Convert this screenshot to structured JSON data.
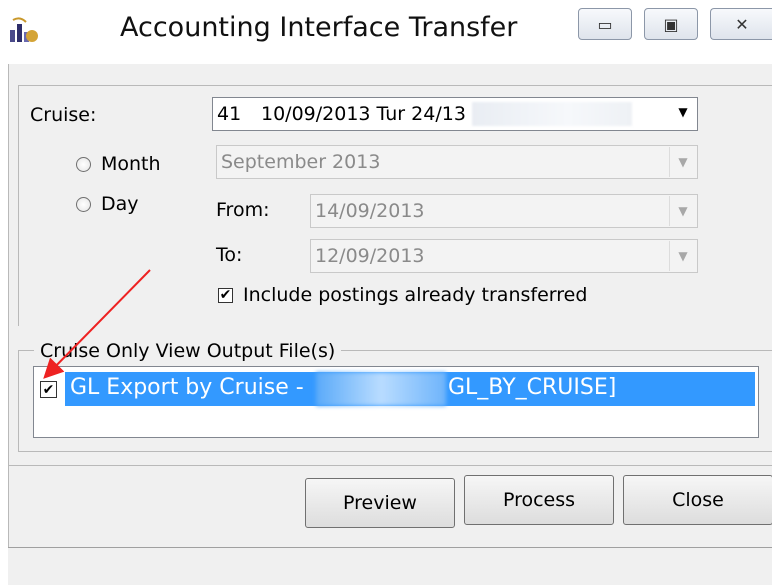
{
  "window": {
    "title": "Accounting Interface Transfer",
    "min_icon": "minimize-icon",
    "max_icon": "maximize-icon",
    "close_icon": "close-icon"
  },
  "form": {
    "cruise_label": "Cruise:",
    "cruise_value_id": "41",
    "cruise_value_desc": "10/09/2013 Tur 24/13",
    "month_label": "Month",
    "day_label": "Day",
    "month_value": "September 2013",
    "from_label": "From:",
    "from_value": "14/09/2013",
    "to_label": "To:",
    "to_value": "12/09/2013",
    "include_label": "Include postings already transferred",
    "include_checked": true
  },
  "output": {
    "group_label": "Cruise Only View Output File(s)",
    "items": [
      {
        "prefix": "GL Export by Cruise -",
        "suffix": "GL_BY_CRUISE]",
        "checked": true,
        "selected": true
      }
    ]
  },
  "buttons": {
    "preview": "Preview",
    "process": "Process",
    "close": "Close"
  },
  "colors": {
    "selection": "#3399ff",
    "annotation_arrow": "#ee2222"
  }
}
